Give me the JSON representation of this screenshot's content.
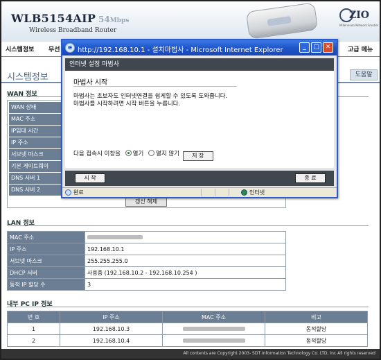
{
  "header": {
    "model": "WLB5154AIP",
    "speed_num": "54",
    "speed_unit": "Mbps",
    "tagline": "Wireless Broadband Router",
    "brand": "ZIO",
    "brand_sub": "Millennium Network Frontier"
  },
  "nav": {
    "items": [
      "시스템정보",
      "무선"
    ],
    "advanced": "고급 메뉴"
  },
  "page": {
    "title": "시스템정보",
    "help": "도움말"
  },
  "wan": {
    "title": "WAN 정보",
    "labels": [
      "WAN 상태",
      "MAC 주소",
      "IP임대 시간",
      "IP 주소",
      "서브넷 마스크",
      "기본 게이트웨이",
      "DNS 서버 1",
      "DNS 서버 2"
    ],
    "release_button": "갱신 해제"
  },
  "lan": {
    "title": "LAN 정보",
    "rows": [
      {
        "label": "MAC 주소",
        "value": ""
      },
      {
        "label": "IP 주소",
        "value": "192.168.10.1"
      },
      {
        "label": "서브넷 마스크",
        "value": "255.255.255.0"
      },
      {
        "label": "DHCP 서버",
        "value": "사용중 (192.168.10.2 - 192.168.10.254 )"
      },
      {
        "label": "동적 IP 할당 수",
        "value": "3"
      }
    ]
  },
  "pc": {
    "title": "내부 PC IP 정보",
    "columns": [
      "번 호",
      "IP 주소",
      "MAC 주소",
      "비고"
    ],
    "rows": [
      {
        "no": "1",
        "ip": "192.168.10.3",
        "mac": "",
        "note": "동적할당"
      },
      {
        "no": "2",
        "ip": "192.168.10.4",
        "mac": "",
        "note": "동적할당"
      }
    ]
  },
  "footer": {
    "copyright": "All contents are Copyright 2003- SDT Information Technology Co. LTD, Inc All rights reserved"
  },
  "dialog": {
    "window_title": "http://192.168.10.1 - 설치마법사 - Microsoft Internet Explorer",
    "header": "인터넷 설정 마법사",
    "subtitle": "마법사 시작",
    "description": "마법사는 초보자도 인터넷연결을 쉽게할 수 있도록 도와줍니다.\n마법사를 시작하려면 시작 버튼을 누릅니다.",
    "option_label": "다음 접속시 이창을",
    "option_open": "열기",
    "option_closed": "열지 않기",
    "option_selected": "열기",
    "save_button": "저  장",
    "start_button": "시  작",
    "close_button": "종  료",
    "status_done": "완료",
    "status_zone": "인터넷"
  },
  "colors": {
    "accent_blue": "#2b5cc8",
    "table_label_bg": "#6b7e93",
    "wizard_dark": "#40474f",
    "footer_bg": "#333333"
  }
}
